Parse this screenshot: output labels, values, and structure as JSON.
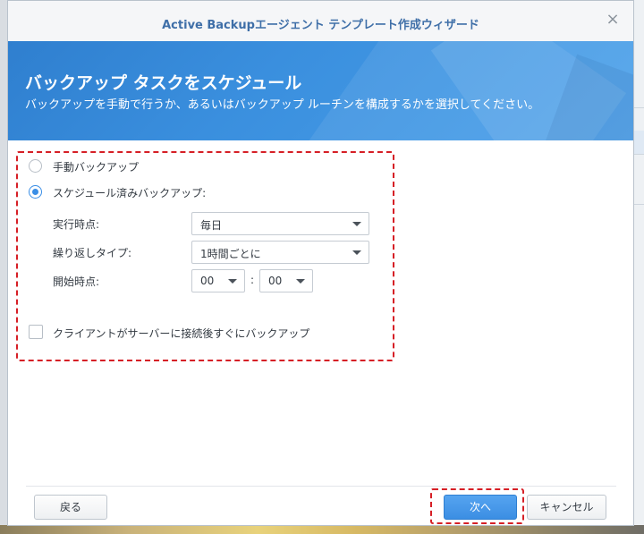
{
  "window": {
    "title": "Active Backupエージェント テンプレート作成ウィザード",
    "close_icon": "×"
  },
  "banner": {
    "title": "バックアップ タスクをスケジュール",
    "subtitle": "バックアップを手動で行うか、あるいはバックアップ ルーチンを構成するかを選択してください。"
  },
  "options": {
    "manual_label": "手動バックアップ",
    "manual_selected": false,
    "scheduled_label": "スケジュール済みバックアップ:",
    "scheduled_selected": true
  },
  "schedule": {
    "run_time_label": "実行時点:",
    "run_time_value": "毎日",
    "repeat_label": "繰り返しタイプ:",
    "repeat_value": "1時間ごとに",
    "start_label": "開始時点:",
    "start_hour": "00",
    "time_separator": ":",
    "start_minute": "00"
  },
  "after_connect": {
    "label": "クライアントがサーバーに接続後すぐにバックアップ",
    "checked": false
  },
  "footer": {
    "back_label": "戻る",
    "next_label": "次へ",
    "cancel_label": "キャンセル"
  },
  "colors": {
    "accent": "#3a8ee6",
    "title_text": "#3f6fa8",
    "highlight": "#d61f26"
  }
}
